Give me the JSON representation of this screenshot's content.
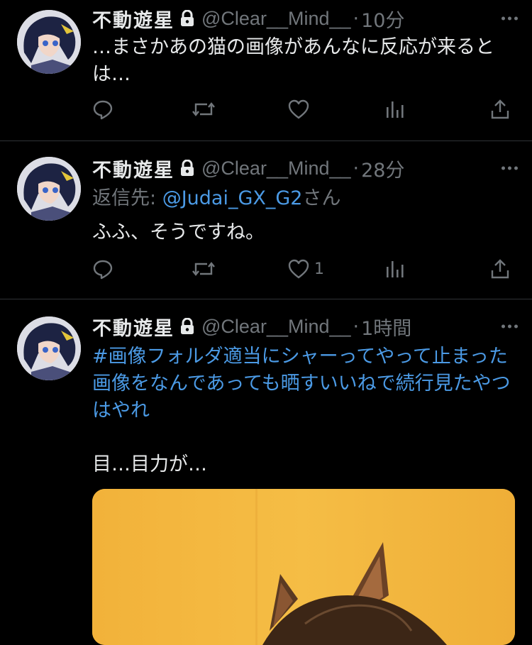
{
  "colors": {
    "background": "#000000",
    "text": "#e7e9ea",
    "muted": "#71767b",
    "link": "#4b9ae5",
    "divider": "#2f3336"
  },
  "tweets": [
    {
      "display_name": "不動遊星",
      "handle": "@Clear__Mind__",
      "separator": "·",
      "time": "10分",
      "text": "…まさかあの猫の画像があんなに反応が来るとは…",
      "reply_label": "",
      "reply_to": "",
      "reply_suffix": "",
      "likes": ""
    },
    {
      "display_name": "不動遊星",
      "handle": "@Clear__Mind__",
      "separator": "·",
      "time": "28分",
      "reply_label": "返信先:",
      "reply_to": "@Judai_GX_G2",
      "reply_suffix": "さん",
      "text": "ふふ、そうですね。",
      "likes": "1"
    },
    {
      "display_name": "不動遊星",
      "handle": "@Clear__Mind__",
      "separator": "·",
      "time": "1時間",
      "hashtag": "#画像フォルダ適当にシャーってやって止まった画像をなんであっても晒すいいねで続行見たやつはやれ",
      "text": "目…目力が…",
      "likes": ""
    }
  ],
  "icons": {
    "verified_lock": "lock-icon",
    "reply": "reply-icon",
    "retweet": "retweet-icon",
    "like": "heart-icon",
    "views": "views-icon",
    "share": "share-icon",
    "more": "more-icon"
  }
}
